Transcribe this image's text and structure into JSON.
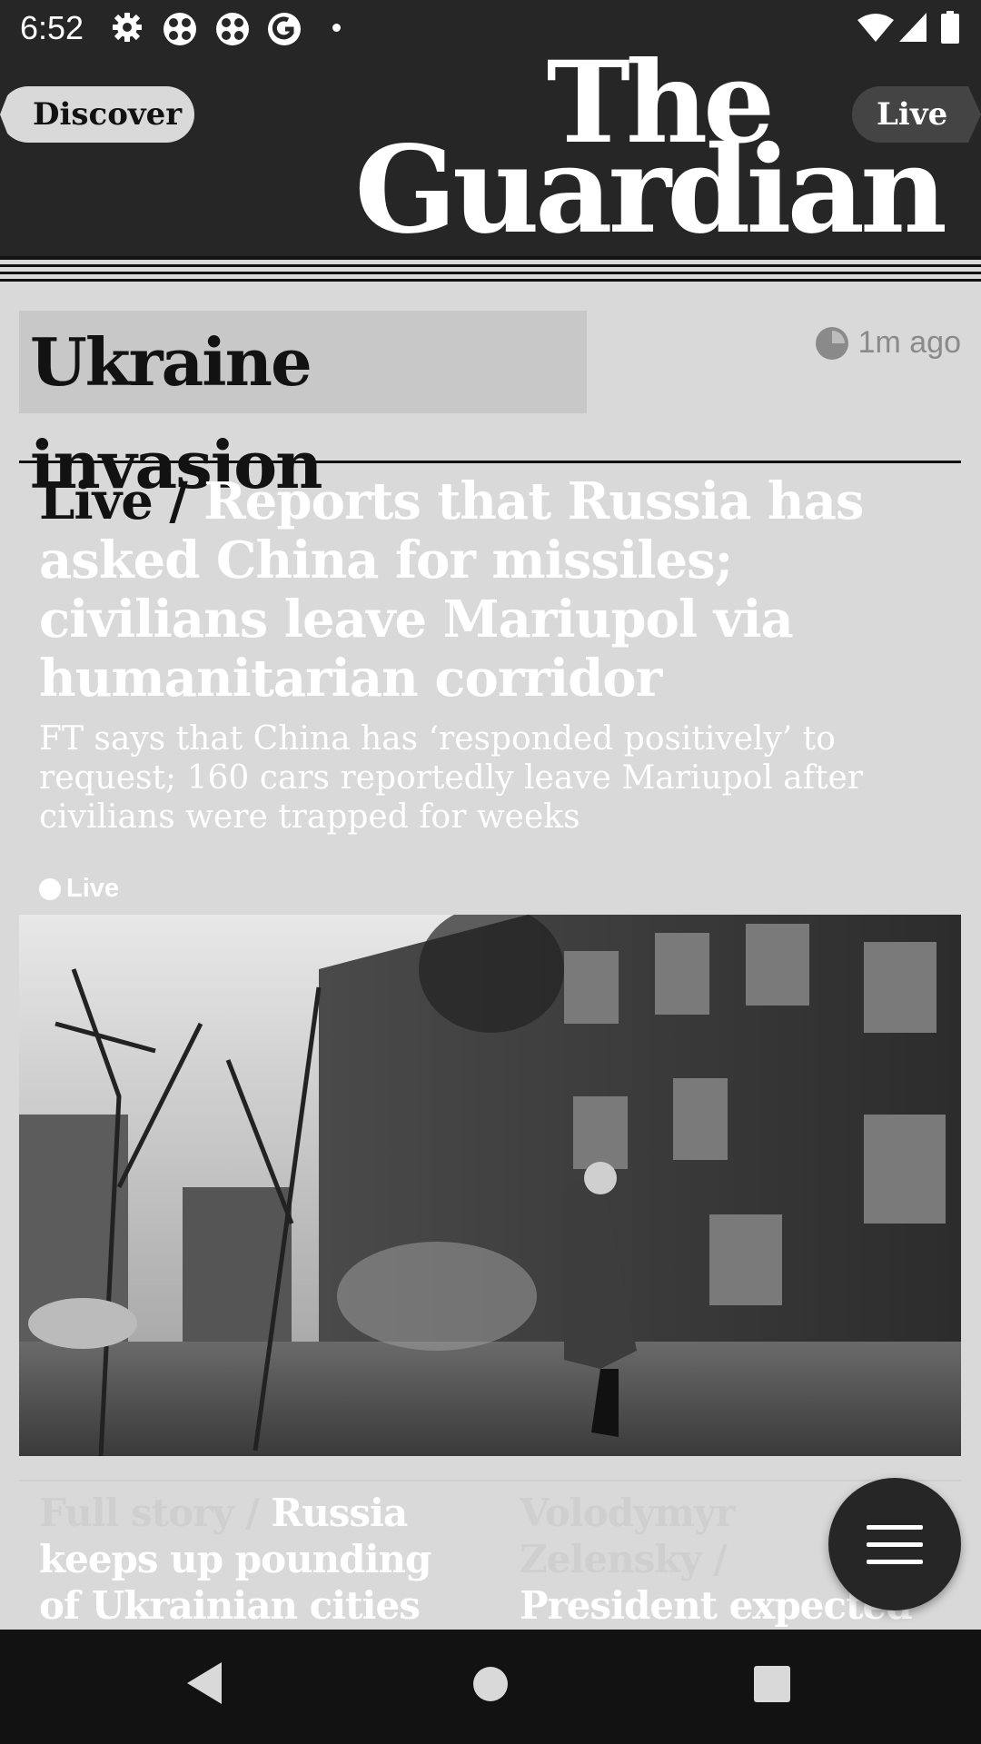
{
  "status_bar": {
    "time": "6:52",
    "icons": [
      "gear-icon",
      "fan-icon",
      "fan-icon",
      "guardian-g-icon",
      "dot-icon",
      "wifi-icon",
      "cell-signal-icon",
      "battery-icon"
    ]
  },
  "header": {
    "discover_label": "Discover",
    "live_label": "Live",
    "logo_line1": "The",
    "logo_line2": "Guardian"
  },
  "section": {
    "title": "Ukraine invasion",
    "timestamp": "1m ago"
  },
  "lead_story": {
    "kicker": "Live / ",
    "headline": "Reports that Russia has asked China for missiles; civilians leave Mariupol via humanitarian corridor",
    "standfirst": "FT says that China has ‘responded positively’ to request; 160 cars reportedly leave Mariupol after civilians were trapped for weeks",
    "live_badge": "Live"
  },
  "cards": [
    {
      "kicker": "Full story / ",
      "headline": "Russia keeps up pounding of Ukrainian cities amid"
    },
    {
      "kicker": "Volodymyr Zelensky / ",
      "headline": "President expected to urge jet transfer in"
    }
  ],
  "colors": {
    "background": "#d9d9d9",
    "header": "#262626",
    "nav_bar": "#121212",
    "headline_white": "#ffffff",
    "kicker_dark": "#121212"
  },
  "nav_bar": {
    "icons": [
      "back-icon",
      "home-icon",
      "recents-icon"
    ]
  }
}
